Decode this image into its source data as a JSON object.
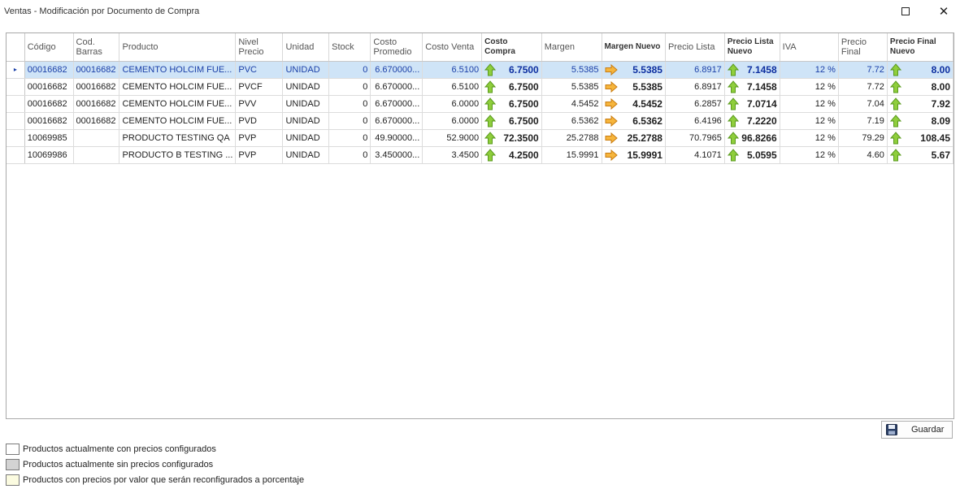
{
  "window": {
    "title": "Ventas - Modificación por Documento de Compra"
  },
  "grid": {
    "columns": [
      {
        "key": "codigo",
        "label": "Código"
      },
      {
        "key": "cod_barras",
        "label": "Cod.\nBarras"
      },
      {
        "key": "producto",
        "label": "Producto"
      },
      {
        "key": "nivel_precio",
        "label": "Nivel\nPrecio"
      },
      {
        "key": "unidad",
        "label": "Unidad"
      },
      {
        "key": "stock",
        "label": "Stock"
      },
      {
        "key": "costo_promedio",
        "label": "Costo\nPromedio"
      },
      {
        "key": "costo_venta",
        "label": "Costo Venta"
      },
      {
        "key": "costo_compra",
        "label": "Costo\nCompra"
      },
      {
        "key": "margen",
        "label": "Margen"
      },
      {
        "key": "margen_nuevo",
        "label": "Margen Nuevo"
      },
      {
        "key": "precio_lista",
        "label": "Precio Lista"
      },
      {
        "key": "precio_lista_nuevo",
        "label": "Precio Lista\nNuevo"
      },
      {
        "key": "iva",
        "label": "IVA"
      },
      {
        "key": "precio_final",
        "label": "Precio Final"
      },
      {
        "key": "precio_final_nuevo",
        "label": "Precio Final\nNuevo"
      }
    ],
    "rows": [
      {
        "codigo": "00016682",
        "cod_barras": "00016682",
        "producto": "CEMENTO HOLCIM FUE...",
        "nivel_precio": "PVC",
        "unidad": "UNIDAD",
        "stock": "0",
        "costo_promedio": "6.670000...",
        "costo_venta": "6.5100",
        "costo_compra": "6.7500",
        "margen": "5.5385",
        "margen_nuevo": "5.5385",
        "precio_lista": "6.8917",
        "precio_lista_nuevo": "7.1458",
        "iva": "12 %",
        "precio_final": "7.72",
        "precio_final_nuevo": "8.00"
      },
      {
        "codigo": "00016682",
        "cod_barras": "00016682",
        "producto": "CEMENTO HOLCIM FUE...",
        "nivel_precio": "PVCF",
        "unidad": "UNIDAD",
        "stock": "0",
        "costo_promedio": "6.670000...",
        "costo_venta": "6.5100",
        "costo_compra": "6.7500",
        "margen": "5.5385",
        "margen_nuevo": "5.5385",
        "precio_lista": "6.8917",
        "precio_lista_nuevo": "7.1458",
        "iva": "12 %",
        "precio_final": "7.72",
        "precio_final_nuevo": "8.00"
      },
      {
        "codigo": "00016682",
        "cod_barras": "00016682",
        "producto": "CEMENTO HOLCIM FUE...",
        "nivel_precio": "PVV",
        "unidad": "UNIDAD",
        "stock": "0",
        "costo_promedio": "6.670000...",
        "costo_venta": "6.0000",
        "costo_compra": "6.7500",
        "margen": "4.5452",
        "margen_nuevo": "4.5452",
        "precio_lista": "6.2857",
        "precio_lista_nuevo": "7.0714",
        "iva": "12 %",
        "precio_final": "7.04",
        "precio_final_nuevo": "7.92"
      },
      {
        "codigo": "00016682",
        "cod_barras": "00016682",
        "producto": "CEMENTO HOLCIM FUE...",
        "nivel_precio": "PVD",
        "unidad": "UNIDAD",
        "stock": "0",
        "costo_promedio": "6.670000...",
        "costo_venta": "6.0000",
        "costo_compra": "6.7500",
        "margen": "6.5362",
        "margen_nuevo": "6.5362",
        "precio_lista": "6.4196",
        "precio_lista_nuevo": "7.2220",
        "iva": "12 %",
        "precio_final": "7.19",
        "precio_final_nuevo": "8.09"
      },
      {
        "codigo": "10069985",
        "cod_barras": "",
        "producto": "PRODUCTO TESTING QA",
        "nivel_precio": "PVP",
        "unidad": "UNIDAD",
        "stock": "0",
        "costo_promedio": "49.90000...",
        "costo_venta": "52.9000",
        "costo_compra": "72.3500",
        "margen": "25.2788",
        "margen_nuevo": "25.2788",
        "precio_lista": "70.7965",
        "precio_lista_nuevo": "96.8266",
        "iva": "12 %",
        "precio_final": "79.29",
        "precio_final_nuevo": "108.45"
      },
      {
        "codigo": "10069986",
        "cod_barras": "",
        "producto": "PRODUCTO B TESTING ...",
        "nivel_precio": "PVP",
        "unidad": "UNIDAD",
        "stock": "0",
        "costo_promedio": "3.450000...",
        "costo_venta": "3.4500",
        "costo_compra": "4.2500",
        "margen": "15.9991",
        "margen_nuevo": "15.9991",
        "precio_lista": "4.1071",
        "precio_lista_nuevo": "5.0595",
        "iva": "12 %",
        "precio_final": "4.60",
        "precio_final_nuevo": "5.67"
      }
    ],
    "selected_row": 0,
    "selected_indicator": "▸"
  },
  "toolbar": {
    "save_label": "Guardar",
    "save_icon": "floppy-disk-icon"
  },
  "legend": [
    {
      "label": "Productos actualmente con precios configurados",
      "color": "#ffffff"
    },
    {
      "label": "Productos actualmente sin precios configurados",
      "color": "#d3d3d3"
    },
    {
      "label": "Productos con precios por valor que serán reconfigurados a porcentaje",
      "color": "#fbfbe0"
    }
  ],
  "icons": {
    "increase": "green-up-arrow-icon",
    "same": "orange-right-arrow-icon"
  }
}
